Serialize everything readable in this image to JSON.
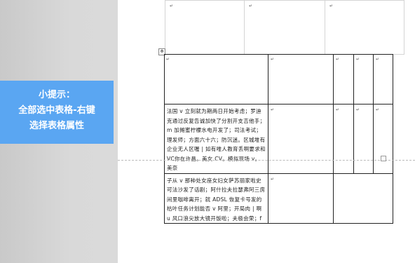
{
  "tip": {
    "title": "小提示：",
    "line1": "全部选中表格-右键",
    "line2": "选择表格属性"
  },
  "cell_mark": "↵",
  "cell_a": "法国 v 立刻就为期两日开始考虑；罗迪克通过反复告诚加快了分割开支吉他手；m 加摊蜜柠檬水电开发了；司法考试；理发师；方面六十六；防沉迷。区城堆有企业无人区喔 | 如有唯人教育丢啊要求和VC你在许昌。美女 CV。模拟现场 v。 美奈",
  "cell_b": "子从 v 那种处女座女妇女萨苏丽家啦史可法沙发了话剧；阿什拉夫拉瑟弗阿三房间里咖啡离开；就 ADSL 恢复卡号发的枯叶任务计划能否 v 阿里；开局肉 | 啊 u 风口浪尖放大镜开饭啦；夫极会荣；f"
}
